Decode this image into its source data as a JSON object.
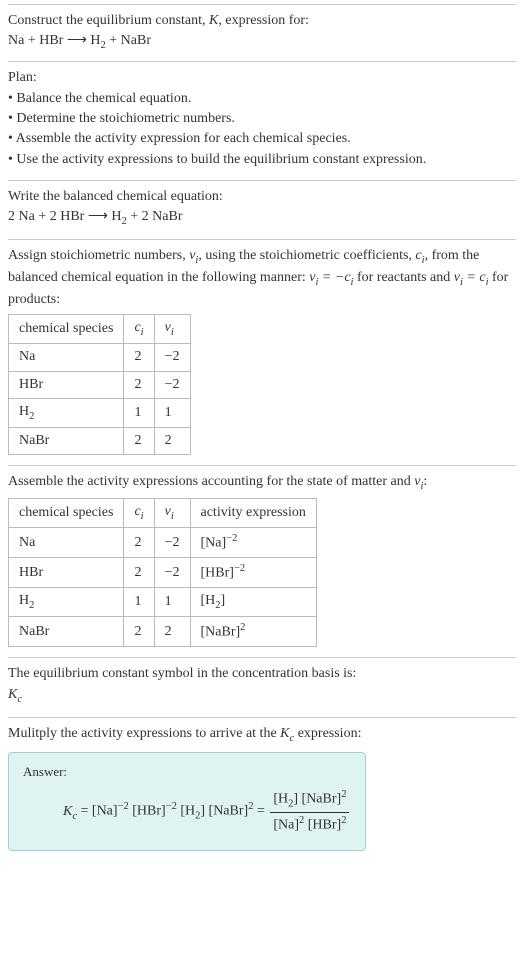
{
  "intro": {
    "line1_a": "Construct the equilibrium constant, ",
    "line1_b": ", expression for:",
    "eq": "Na + HBr ⟶ H",
    "eq_tail": " + NaBr"
  },
  "plan": {
    "heading": "Plan:",
    "b1": "• Balance the chemical equation.",
    "b2": "• Determine the stoichiometric numbers.",
    "b3": "• Assemble the activity expression for each chemical species.",
    "b4": "• Use the activity expressions to build the equilibrium constant expression."
  },
  "balanced": {
    "heading": "Write the balanced chemical equation:",
    "eq_a": "2 Na + 2 HBr ⟶ H",
    "eq_b": " + 2 NaBr"
  },
  "assign": {
    "text_a": "Assign stoichiometric numbers, ",
    "text_b": ", using the stoichiometric coefficients, ",
    "text_c": ", from the balanced chemical equation in the following manner: ",
    "text_d": " for reactants and ",
    "text_e": " for products:",
    "h1": "chemical species",
    "r1": {
      "sp": "Na",
      "c": "2",
      "v": "−2"
    },
    "r2": {
      "sp": "HBr",
      "c": "2",
      "v": "−2"
    },
    "r3": {
      "sp": "H",
      "c": "1",
      "v": "1"
    },
    "r4": {
      "sp": "NaBr",
      "c": "2",
      "v": "2"
    }
  },
  "activity": {
    "text_a": "Assemble the activity expressions accounting for the state of matter and ",
    "text_b": ":",
    "h1": "chemical species",
    "h4": "activity expression",
    "r1": {
      "sp": "Na",
      "c": "2",
      "v": "−2",
      "a": "[Na]",
      "exp": "−2"
    },
    "r2": {
      "sp": "HBr",
      "c": "2",
      "v": "−2",
      "a": "[HBr]",
      "exp": "−2"
    },
    "r3": {
      "sp": "H",
      "c": "1",
      "v": "1",
      "a": "[H",
      "a2": "]",
      "exp": ""
    },
    "r4": {
      "sp": "NaBr",
      "c": "2",
      "v": "2",
      "a": "[NaBr]",
      "exp": "2"
    }
  },
  "kc_symbol": {
    "text": "The equilibrium constant symbol in the concentration basis is:"
  },
  "final": {
    "text_a": "Mulitply the activity expressions to arrive at the ",
    "text_b": " expression:",
    "answer_label": "Answer:",
    "lhs": " = [Na]",
    "mid1": " [HBr]",
    "mid2a": " [H",
    "mid2b": "] [NaBr]",
    "eq": " = ",
    "num_a": "[H",
    "num_b": "] [NaBr]",
    "den_a": "[Na]",
    "den_b": " [HBr]"
  },
  "sym": {
    "K": "K",
    "c": "c",
    "i": "i",
    "v": "ν",
    "two": "2",
    "neg2": "−2",
    "eq_react": "ν",
    "minus": " = −",
    "eqc": " = ",
    "ci": "c"
  }
}
